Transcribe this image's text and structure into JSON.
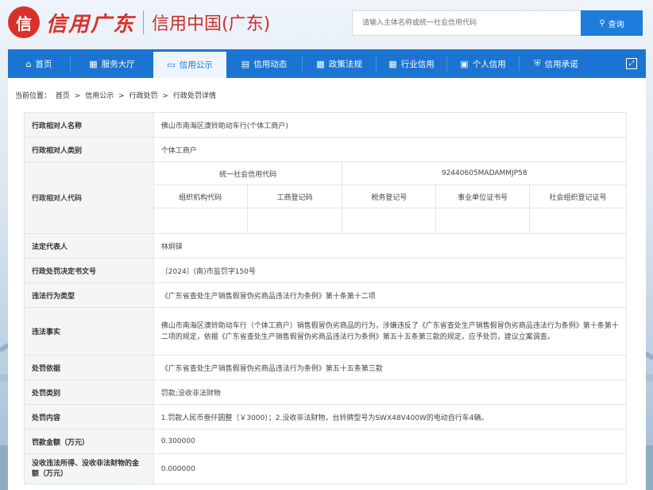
{
  "header": {
    "logo_char": "信",
    "logo_cn": "信用广东",
    "logo_sub": "信用中国(广东)",
    "search_placeholder": "请输入主体名称或统一社会信用代码",
    "search_button": "查询"
  },
  "nav": {
    "items": [
      {
        "label": "首页",
        "icon": "home-icon"
      },
      {
        "label": "服务大厅",
        "icon": "grid-icon"
      },
      {
        "label": "信用公示",
        "icon": "monitor-icon",
        "active": true
      },
      {
        "label": "信用动态",
        "icon": "document-icon"
      },
      {
        "label": "政策法规",
        "icon": "bookmark-icon"
      },
      {
        "label": "行业信用",
        "icon": "building-icon"
      },
      {
        "label": "个人信用",
        "icon": "id-card-icon"
      },
      {
        "label": "信用承诺",
        "icon": "shield-icon"
      }
    ],
    "accent": "#1b74d2"
  },
  "breadcrumb": {
    "prefix": "当前位置：",
    "items": [
      "首页",
      "信用公示",
      "行政处罚",
      "行政处罚详情"
    ],
    "separator": ">"
  },
  "detail": {
    "name_label": "行政相对人名称",
    "name_value": "佛山市南海区澳铃助动车行(个体工商户)",
    "type_label": "行政相对人类别",
    "type_value": "个体工商户",
    "code_label": "行政相对人代码",
    "code_headers": {
      "usc_label": "统一社会信用代码",
      "usc_value": "92440605MADAMMJP58",
      "org": "组织机构代码",
      "biz": "工商登记码",
      "tax": "税务登记号",
      "inst": "事业单位证书号",
      "social": "社会组织登记证号"
    },
    "rep_label": "法定代表人",
    "rep_value": "林炯铎",
    "doc_label": "行政处罚决定书文号",
    "doc_value": "〔2024〕(南)市监罚字150号",
    "viol_type_label": "违法行为类型",
    "viol_type_value": "《广东省查处生产销售假冒伪劣商品违法行为条例》第十条第十二项",
    "fact_label": "违法事实",
    "fact_value": "佛山市南海区澳铃助动车行（个体工商户）销售假冒伪劣商品的行为，涉嫌违反了《广东省查处生产销售假冒伪劣商品违法行为条例》第十条第十二项的规定，依据《广东省查处生产销售假冒伪劣商品违法行为条例》第五十五条第三款的规定，应予处罚，建议立案调查。",
    "basis_label": "处罚依据",
    "basis_value": "《广东省查处生产销售假冒伪劣商品违法行为条例》第五十五条第三款",
    "category_label": "处罚类别",
    "category_value": "罚款;没收非法财物",
    "content_label": "处罚内容",
    "content_value": "1.罚款人民币叁仟圆整（￥3000）；2.没收非法财物，台铃牌型号为SWX48V400W的电动自行车4辆。",
    "fine_label": "罚款金额（万元）",
    "fine_value": "0.300000",
    "confisc_label": "没收违法所得、没收非法财物的金额（万元）",
    "confisc_value": "0.000000"
  }
}
